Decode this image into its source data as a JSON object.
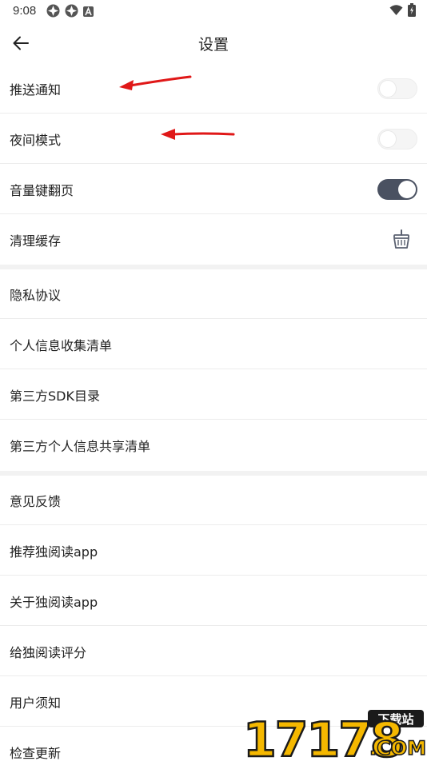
{
  "status_bar": {
    "time": "9:08",
    "left_icons": [
      "app-notification-icon",
      "app-notification-icon",
      "a-letter-icon"
    ],
    "right_icons": [
      "wifi-icon",
      "battery-charging-icon"
    ]
  },
  "header": {
    "title": "设置",
    "back_icon": "arrow-left-icon"
  },
  "settings": {
    "push_notification": {
      "label": "推送通知",
      "enabled": false
    },
    "night_mode": {
      "label": "夜间模式",
      "enabled": false
    },
    "volume_key_page": {
      "label": "音量键翻页",
      "enabled": true
    },
    "clear_cache": {
      "label": "清理缓存",
      "icon": "broom-basket-icon"
    }
  },
  "info_links": [
    {
      "label": "隐私协议"
    },
    {
      "label": "个人信息收集清单"
    },
    {
      "label": "第三方SDK目录"
    },
    {
      "label": "第三方个人信息共享清单"
    }
  ],
  "other_links": [
    {
      "label": "意见反馈"
    },
    {
      "label": "推荐独阅读app"
    },
    {
      "label": "关于独阅读app"
    },
    {
      "label": "给独阅读评分"
    },
    {
      "label": "用户须知"
    },
    {
      "label": "检查更新"
    }
  ],
  "colors": {
    "toggle_on": "#4a5161",
    "toggle_off": "#f5f5f5",
    "divider": "#ececec",
    "section_gap": "#f2f2f2",
    "annotation_arrow": "#e01818"
  },
  "watermark": {
    "text": "17178",
    "badge": "下载站",
    "suffix": ".COM"
  }
}
